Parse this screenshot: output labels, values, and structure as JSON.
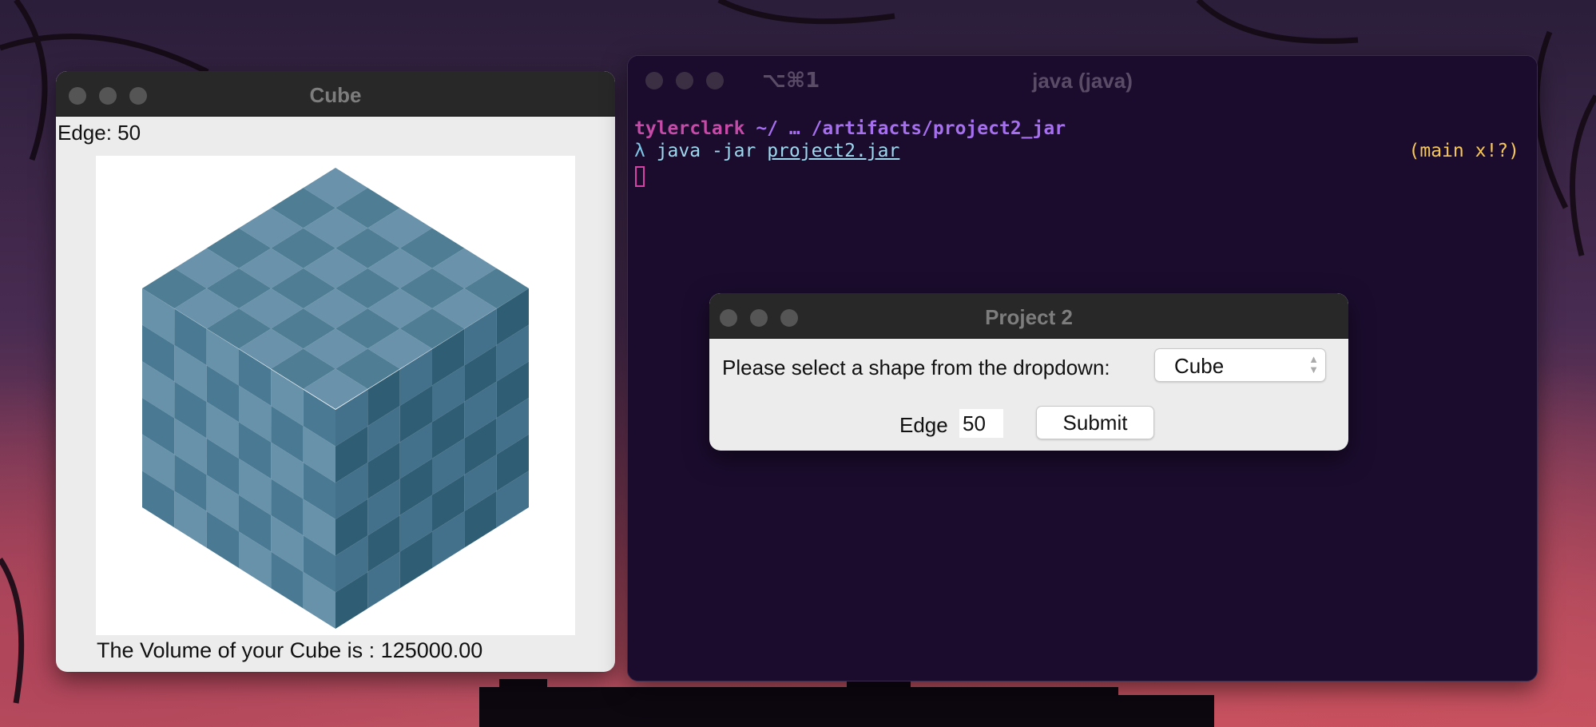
{
  "cube_window": {
    "title": "Cube",
    "edge_text": "Edge: 50",
    "volume_text": "The Volume of your Cube is : 125000.00"
  },
  "terminal": {
    "tab_shortcut": "⌥⌘1",
    "title": "java (java)",
    "prompt_user": "tylerclark",
    "prompt_path": " ~/ … /artifacts/project2_jar",
    "lambda": "λ",
    "command": " java -jar ",
    "command_arg": "project2.jar",
    "git_status": "(main x!?)"
  },
  "dialog": {
    "title": "Project 2",
    "prompt": "Please select a shape from the dropdown:",
    "shape_selected": "Cube",
    "edge_label": "Edge",
    "edge_value": "50",
    "submit_label": "Submit"
  },
  "colors": {
    "terminal_bg": "#1b0c2e",
    "prompt_user": "#c64aa7",
    "prompt_path": "#a66ff0",
    "git_status": "#f6c75a",
    "cube_light": "#6a8fa6",
    "cube_dark": "#3e6c84"
  }
}
